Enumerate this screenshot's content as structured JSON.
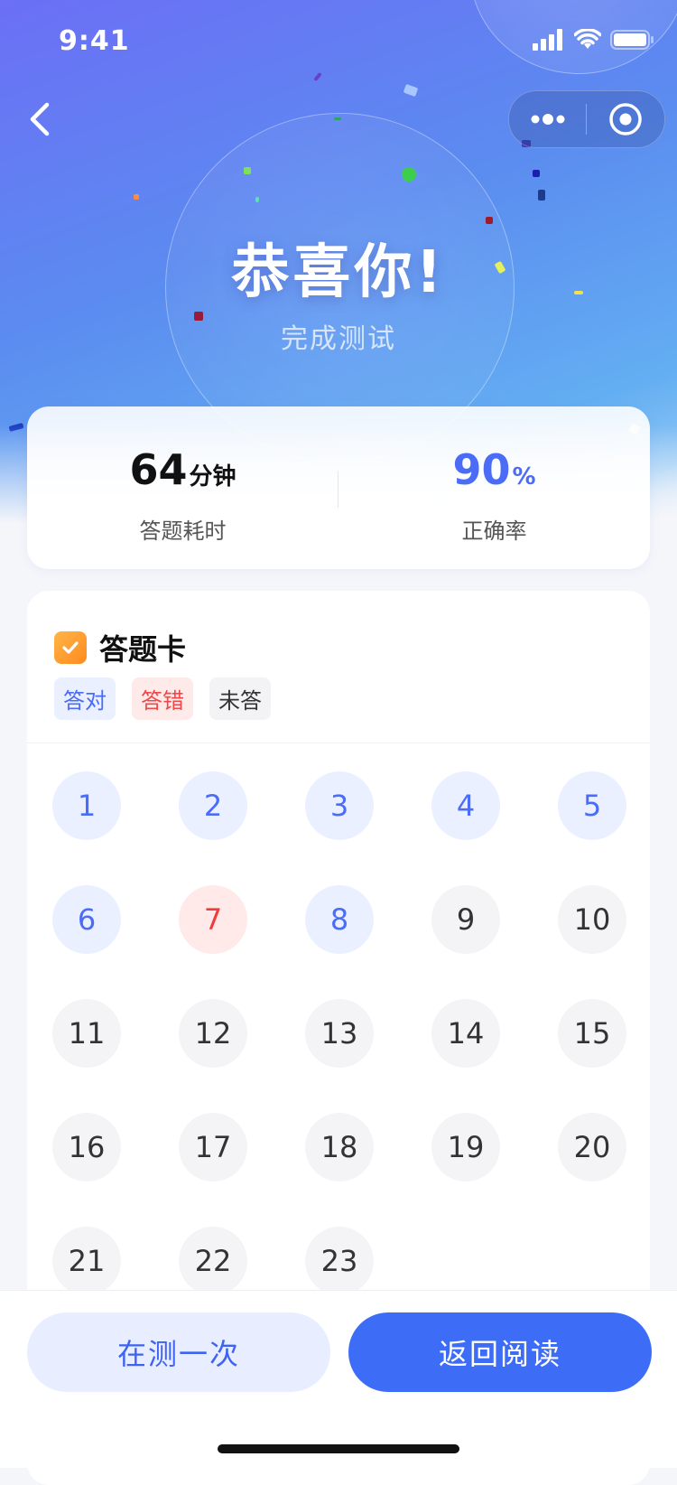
{
  "status_bar": {
    "time": "9:41"
  },
  "header": {
    "title": "恭喜你!",
    "subtitle": "完成测试"
  },
  "stats": {
    "time": {
      "value": "64",
      "unit": "分钟",
      "label": "答题耗时"
    },
    "accuracy": {
      "value": "90",
      "unit": "%",
      "label": "正确率"
    }
  },
  "answer_card": {
    "title": "答题卡",
    "legend": {
      "correct": "答对",
      "wrong": "答错",
      "unanswered": "未答"
    },
    "questions": [
      {
        "n": "1",
        "status": "correct"
      },
      {
        "n": "2",
        "status": "correct"
      },
      {
        "n": "3",
        "status": "correct"
      },
      {
        "n": "4",
        "status": "correct"
      },
      {
        "n": "5",
        "status": "correct"
      },
      {
        "n": "6",
        "status": "correct"
      },
      {
        "n": "7",
        "status": "wrong"
      },
      {
        "n": "8",
        "status": "correct"
      },
      {
        "n": "9",
        "status": "none"
      },
      {
        "n": "10",
        "status": "none"
      },
      {
        "n": "11",
        "status": "none"
      },
      {
        "n": "12",
        "status": "none"
      },
      {
        "n": "13",
        "status": "none"
      },
      {
        "n": "14",
        "status": "none"
      },
      {
        "n": "15",
        "status": "none"
      },
      {
        "n": "16",
        "status": "none"
      },
      {
        "n": "17",
        "status": "none"
      },
      {
        "n": "18",
        "status": "none"
      },
      {
        "n": "19",
        "status": "none"
      },
      {
        "n": "20",
        "status": "none"
      },
      {
        "n": "21",
        "status": "none"
      },
      {
        "n": "22",
        "status": "none"
      },
      {
        "n": "23",
        "status": "none"
      }
    ]
  },
  "actions": {
    "retry_label": "在测一次",
    "back_label": "返回阅读"
  },
  "colors": {
    "accent": "#3d6cf7",
    "correct": "#4a6cf7",
    "wrong": "#f03c3c",
    "card_icon": "#ff9a2e"
  },
  "icons": [
    "signal-icon",
    "wifi-icon",
    "battery-icon",
    "back-arrow-icon",
    "more-dots-icon",
    "target-close-icon",
    "checkmark-icon"
  ]
}
